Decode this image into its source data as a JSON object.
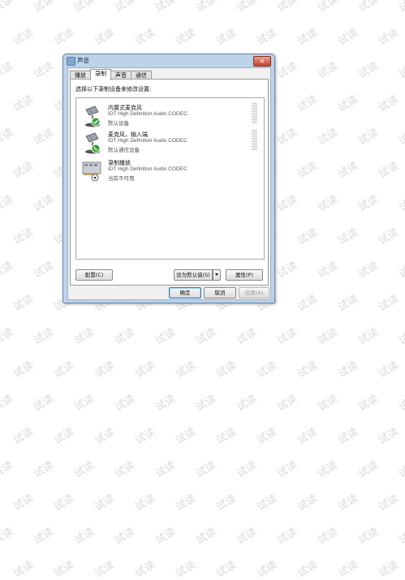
{
  "watermark": {
    "text": "试读"
  },
  "window": {
    "title": "声音",
    "close_glyph": "✕",
    "tabs": [
      {
        "label": "播放",
        "active": false
      },
      {
        "label": "录制",
        "active": true
      },
      {
        "label": "声音",
        "active": false
      },
      {
        "label": "通信",
        "active": false
      }
    ],
    "instruction": "选择以下录制设备来修改设置:",
    "devices": [
      {
        "name": "内置式麦克风",
        "driver": "IDT High Definition Audio CODEC",
        "status": "默认设备",
        "icon": "microphone-icon",
        "badge": "default-check-badge"
      },
      {
        "name": "麦克风，输入端",
        "driver": "IDT High Definition Audio CODEC",
        "status": "默认通信设备",
        "icon": "microphone-icon",
        "badge": "communication-phone-badge"
      },
      {
        "name": "录制播放",
        "driver": "IDT High Definition Audio CODEC",
        "status": "当前不可用",
        "icon": "sound-card-icon",
        "badge": "unavailable-down-badge"
      }
    ],
    "buttons": {
      "configure": "配置(C)",
      "set_default": "设为默认值(S)",
      "properties": "属性(P)",
      "ok": "确定",
      "cancel": "取消",
      "apply": "应用(A)"
    }
  }
}
